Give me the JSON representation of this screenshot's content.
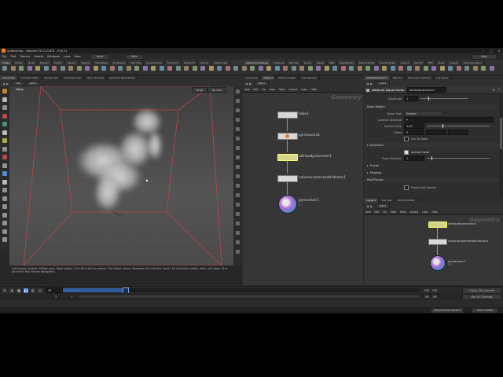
{
  "window": {
    "title": "untitled.hip - Houdini FX 21.0.671 - Py3.11"
  },
  "menubar": {
    "items": [
      "File",
      "Edit",
      "Render",
      "Assets",
      "Windows",
      "Labs",
      "Help"
    ],
    "desktop_menu": "Build",
    "main_menu": "Main",
    "right_label": "Main"
  },
  "shelf": {
    "tabs": [
      "Create",
      "Modify",
      "Model",
      "Polygon",
      "Deform",
      "Texture",
      "Rigging",
      "Characters",
      "Constraints",
      "Hair Utils",
      "Guide Process",
      "Terrain FX",
      "Simple FX",
      "Volume",
      "SideFX Labs"
    ],
    "tabs_right": [
      "Lights and Cameras",
      "Collisions",
      "Particles",
      "Grains",
      "Vellum",
      "RBD",
      "Rigid Bodies",
      "Particle Fluids",
      "Viscous Fluids",
      "Oceans",
      "Pyro FX",
      "FEM",
      "Wires",
      "Crowds",
      "Drive Simulation"
    ]
  },
  "left_pane": {
    "tabs": [
      "Scene View",
      "Animation Editor",
      "Render View",
      "Composite View",
      "Motion FX View",
      "Geometry Spreadsheet"
    ],
    "path": "obj",
    "path2": "geo1",
    "view_label": "View",
    "persp": "Persp",
    "cam": "No cam",
    "status_text": "Left mouse tumbles. Middle pans. Right dollies. Ctrl+Alt+Left box-zooms. Ctrl+Right zooms. Spacebar-Ctrl-Left tilts. Hold L for alternate tumble, dolly, and zoom. M or Alt+M for First Person Navigation."
  },
  "network_top": {
    "tabs": [
      "Scene View",
      "obj/geo1",
      "Material Palette",
      "Asset Browser"
    ],
    "path": "geo1",
    "menu": [
      "Add",
      "Edit",
      "Go",
      "View",
      "Tools",
      "Layout",
      "Labs",
      "Help"
    ],
    "context_label": "Geometry",
    "nodes": [
      "tube1",
      "pyrosource1",
      "attribadjustvector1",
      "volumerasterizeattributes1",
      "pyrosolver1"
    ],
    "solver_sub": "0 1"
  },
  "params": {
    "tabs": [
      "attribadjustvector1",
      "Take List",
      "Performance Monitor",
      "Log Viewer"
    ],
    "node_type": "Attribute Adjust Vector",
    "node_name": "attribadjustvector1",
    "amplitude_label": "Amplitude",
    "amplitude_value": "1",
    "noise_pattern_label": "Noise Pattern",
    "noise_type_label": "Noise Type",
    "noise_type_value": "Simplex",
    "location_attr_label": "Location Attribute",
    "location_attr_value": "P",
    "element_size_label": "Element Size",
    "element_size_value": "1.55",
    "offset_label": "Offset",
    "offset_value": "0",
    "use_4d_label": "Use 4D Noise",
    "animation_label": "Animation",
    "animate_noise_label": "Animate Noise",
    "pulse_label": "Pulse Duration",
    "pulse_value": "1",
    "fractal_label": "Fractal",
    "mapping_label": "Mapping",
    "post_process_label": "Post Process",
    "enable_post_label": "Enable Post-Process"
  },
  "network_bottom": {
    "tabs": [
      "obj/geo1",
      "Tree View",
      "Material Palette"
    ],
    "path": "geo1",
    "menu": [
      "Add",
      "Edit",
      "Go",
      "View",
      "Tools",
      "Layout",
      "Labs",
      "Help"
    ],
    "context_label": "Geometry",
    "nodes": [
      "attribadjustvector1",
      "volumerasterizeattributes1",
      "pyrosolver1"
    ],
    "solver_sub": "0 1"
  },
  "timeline": {
    "current_frame": "43",
    "start": "1",
    "start2": "1",
    "end": "240",
    "end2": "240",
    "progress": 0.175,
    "keys_label": "0 keys, 0/0 channels",
    "key_all_label": "Key All Channels"
  },
  "statusbar": {
    "path": "/obj/geo1/pyrosolver1",
    "update": "Auto Update"
  },
  "colors": {
    "accent": "#4a7fc4",
    "selected_node": "#d6d38a",
    "solver": "#5aa0d8"
  }
}
